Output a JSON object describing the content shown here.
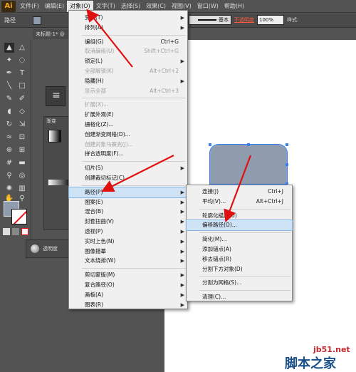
{
  "app": {
    "logo": "Ai"
  },
  "menubar": [
    {
      "label": "文件(F)",
      "active": false
    },
    {
      "label": "编辑(E)",
      "active": false
    },
    {
      "label": "对象(O)",
      "active": true
    },
    {
      "label": "文字(T)",
      "active": false
    },
    {
      "label": "选择(S)",
      "active": false
    },
    {
      "label": "效果(C)",
      "active": false
    },
    {
      "label": "视图(V)",
      "active": false
    },
    {
      "label": "窗口(W)",
      "active": false
    },
    {
      "label": "帮助(H)",
      "active": false
    }
  ],
  "controlbar": {
    "label": "路径",
    "stroke_style": "基本",
    "opacity_label": "不透明度",
    "opacity_value": "100%",
    "style_label": "样式:"
  },
  "doc_tab": "未标题-1* @",
  "gradient_panel": {
    "tab": "渐变"
  },
  "opacity_panel": {
    "label": "透明度"
  },
  "object_menu": {
    "items": [
      {
        "label": "变换(T)",
        "shortcut": "",
        "submenu": true,
        "disabled": false,
        "highlight": false,
        "sep_before": false
      },
      {
        "label": "排列(A)",
        "shortcut": "",
        "submenu": true,
        "disabled": false,
        "highlight": false,
        "sep_before": false
      },
      {
        "label": "编组(G)",
        "shortcut": "Ctrl+G",
        "submenu": false,
        "disabled": false,
        "highlight": false,
        "sep_before": true
      },
      {
        "label": "取消编组(U)",
        "shortcut": "Shift+Ctrl+G",
        "submenu": false,
        "disabled": true,
        "highlight": false,
        "sep_before": false
      },
      {
        "label": "锁定(L)",
        "shortcut": "",
        "submenu": true,
        "disabled": false,
        "highlight": false,
        "sep_before": false
      },
      {
        "label": "全部解锁(K)",
        "shortcut": "Alt+Ctrl+2",
        "submenu": false,
        "disabled": true,
        "highlight": false,
        "sep_before": false
      },
      {
        "label": "隐藏(H)",
        "shortcut": "",
        "submenu": true,
        "disabled": false,
        "highlight": false,
        "sep_before": false
      },
      {
        "label": "显示全部",
        "shortcut": "Alt+Ctrl+3",
        "submenu": false,
        "disabled": true,
        "highlight": false,
        "sep_before": false
      },
      {
        "label": "扩展(X)...",
        "shortcut": "",
        "submenu": false,
        "disabled": true,
        "highlight": false,
        "sep_before": true
      },
      {
        "label": "扩展外观(E)",
        "shortcut": "",
        "submenu": false,
        "disabled": false,
        "highlight": false,
        "sep_before": false
      },
      {
        "label": "栅格化(Z)...",
        "shortcut": "",
        "submenu": false,
        "disabled": false,
        "highlight": false,
        "sep_before": false
      },
      {
        "label": "创建渐变网格(D)...",
        "shortcut": "",
        "submenu": false,
        "disabled": false,
        "highlight": false,
        "sep_before": false
      },
      {
        "label": "创建对象马赛克(J)...",
        "shortcut": "",
        "submenu": false,
        "disabled": true,
        "highlight": false,
        "sep_before": false
      },
      {
        "label": "拼合透明度(F)...",
        "shortcut": "",
        "submenu": false,
        "disabled": false,
        "highlight": false,
        "sep_before": false
      },
      {
        "label": "切片(S)",
        "shortcut": "",
        "submenu": true,
        "disabled": false,
        "highlight": false,
        "sep_before": true
      },
      {
        "label": "创建裁切标记(C)",
        "shortcut": "",
        "submenu": false,
        "disabled": false,
        "highlight": false,
        "sep_before": false
      },
      {
        "label": "路径(P)",
        "shortcut": "",
        "submenu": true,
        "disabled": false,
        "highlight": true,
        "sep_before": true
      },
      {
        "label": "图案(E)",
        "shortcut": "",
        "submenu": true,
        "disabled": false,
        "highlight": false,
        "sep_before": false
      },
      {
        "label": "混合(B)",
        "shortcut": "",
        "submenu": true,
        "disabled": false,
        "highlight": false,
        "sep_before": false
      },
      {
        "label": "封套扭曲(V)",
        "shortcut": "",
        "submenu": true,
        "disabled": false,
        "highlight": false,
        "sep_before": false
      },
      {
        "label": "透视(P)",
        "shortcut": "",
        "submenu": true,
        "disabled": false,
        "highlight": false,
        "sep_before": false
      },
      {
        "label": "实时上色(N)",
        "shortcut": "",
        "submenu": true,
        "disabled": false,
        "highlight": false,
        "sep_before": false
      },
      {
        "label": "图像描摹",
        "shortcut": "",
        "submenu": true,
        "disabled": false,
        "highlight": false,
        "sep_before": false
      },
      {
        "label": "文本绕排(W)",
        "shortcut": "",
        "submenu": true,
        "disabled": false,
        "highlight": false,
        "sep_before": false
      },
      {
        "label": "剪切蒙版(M)",
        "shortcut": "",
        "submenu": true,
        "disabled": false,
        "highlight": false,
        "sep_before": true
      },
      {
        "label": "复合路径(O)",
        "shortcut": "",
        "submenu": true,
        "disabled": false,
        "highlight": false,
        "sep_before": false
      },
      {
        "label": "画板(A)",
        "shortcut": "",
        "submenu": true,
        "disabled": false,
        "highlight": false,
        "sep_before": false
      },
      {
        "label": "图表(R)",
        "shortcut": "",
        "submenu": true,
        "disabled": false,
        "highlight": false,
        "sep_before": false
      }
    ]
  },
  "path_submenu": {
    "items": [
      {
        "label": "连接(J)",
        "shortcut": "Ctrl+J",
        "highlight": false,
        "sep_before": false
      },
      {
        "label": "平均(V)...",
        "shortcut": "Alt+Ctrl+J",
        "highlight": false,
        "sep_before": false
      },
      {
        "label": "轮廓化描边(U)",
        "shortcut": "",
        "highlight": false,
        "sep_before": true
      },
      {
        "label": "偏移路径(O)...",
        "shortcut": "",
        "highlight": true,
        "sep_before": false
      },
      {
        "label": "简化(M)...",
        "shortcut": "",
        "highlight": false,
        "sep_before": true
      },
      {
        "label": "添加锚点(A)",
        "shortcut": "",
        "highlight": false,
        "sep_before": false
      },
      {
        "label": "移去锚点(R)",
        "shortcut": "",
        "highlight": false,
        "sep_before": false
      },
      {
        "label": "分割下方对象(D)",
        "shortcut": "",
        "highlight": false,
        "sep_before": false
      },
      {
        "label": "分割为网格(S)...",
        "shortcut": "",
        "highlight": false,
        "sep_before": true
      },
      {
        "label": "清理(C)...",
        "shortcut": "",
        "highlight": false,
        "sep_before": true
      }
    ]
  },
  "colors": {
    "accent_arrow": "#e01010",
    "highlight": "#cfe3f7",
    "shape_fill": "#8f9cae",
    "selection": "#3a7ff0"
  },
  "watermark": {
    "site": "jb51.net",
    "text": "脚本之家"
  }
}
